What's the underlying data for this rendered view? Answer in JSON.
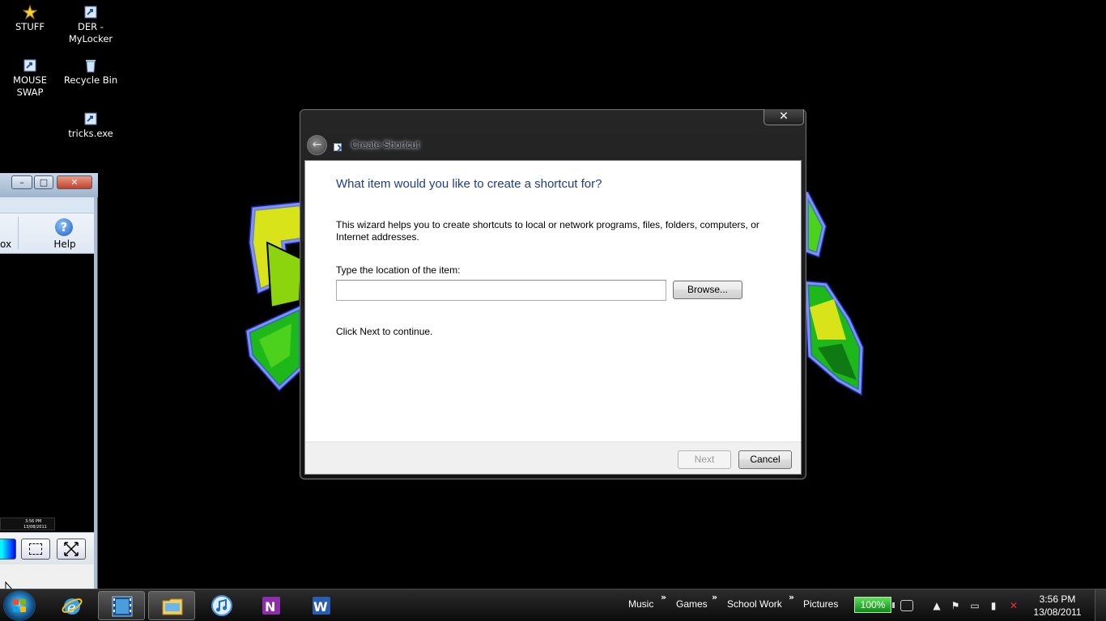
{
  "desktop": {
    "icons": [
      {
        "label": "STUFF",
        "icon": "star-icon"
      },
      {
        "label": "DER - MyLocker",
        "icon": "shortcut-icon"
      },
      {
        "label": "MOUSE SWAP",
        "icon": "shortcut-icon"
      },
      {
        "label": "Recycle Bin",
        "icon": "recycle-bin-icon"
      },
      {
        "label": "tricks.exe",
        "icon": "shortcut-icon"
      }
    ]
  },
  "background_window": {
    "ribbon": {
      "partial_label": "ox",
      "help_label": "Help",
      "help_glyph": "?"
    },
    "tray_thumbnail_time": "3:56 PM",
    "tray_thumbnail_date": "13/08/2011"
  },
  "dialog": {
    "title": "Create Shortcut",
    "close_glyph": "✕",
    "back_glyph": "←",
    "heading": "What item would you like to create a shortcut for?",
    "description": "This wizard helps you to create shortcuts to local or network programs, files, folders, computers, or Internet addresses.",
    "location_label": "Type the location of the item:",
    "location_value": "",
    "browse_label": "Browse...",
    "next_hint": "Click Next to continue.",
    "next_label": "Next",
    "cancel_label": "Cancel"
  },
  "taskbar": {
    "pinned": [
      {
        "name": "internet-explorer",
        "icon": "internet-explorer-icon"
      },
      {
        "name": "video-editor",
        "icon": "film-icon",
        "active": true
      },
      {
        "name": "windows-explorer",
        "icon": "folder-icon"
      },
      {
        "name": "itunes",
        "icon": "music-note-icon"
      },
      {
        "name": "onenote",
        "icon": "onenote-icon"
      },
      {
        "name": "word",
        "icon": "word-icon"
      }
    ],
    "toolbars": [
      "Music",
      "Games",
      "School Work",
      "Pictures"
    ],
    "chevron_glyph": "»",
    "battery": "100%",
    "clock_time": "3:56 PM",
    "clock_date": "13/08/2011"
  },
  "colors": {
    "heading_blue": "#1e3d8c",
    "battery_green": "#2cbf2a",
    "wallpaper_green": "#4cd11d",
    "wallpaper_blue_glow": "#3a5cff"
  }
}
